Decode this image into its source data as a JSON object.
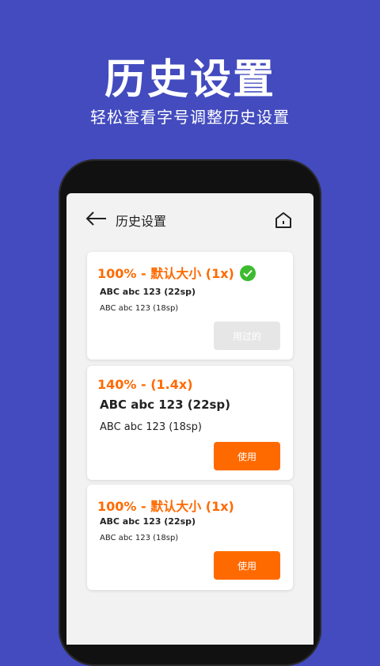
{
  "hero": {
    "title": "历史设置",
    "subtitle": "轻松查看字号调整历史设置"
  },
  "app": {
    "title": "历史设置",
    "back_icon": "arrow-left-icon",
    "home_icon": "home-icon"
  },
  "colors": {
    "background": "#434bbf",
    "accent": "#ff6a00",
    "check": "#3dbb2f",
    "used_button": "#e6e6e6"
  },
  "cards": [
    {
      "heading": "100% - 默认大小 (1x)",
      "sample_large": "ABC abc 123 (22sp)",
      "sample_small": "ABC abc 123 (18sp)",
      "button": "用过的",
      "current": true
    },
    {
      "heading": "140% - (1.4x)",
      "sample_large": "ABC abc 123 (22sp)",
      "sample_small": "ABC abc 123 (18sp)",
      "button": "使用",
      "current": false
    },
    {
      "heading": "100% - 默认大小 (1x)",
      "sample_large": "ABC abc 123 (22sp)",
      "sample_small": "ABC abc 123 (18sp)",
      "button": "使用",
      "current": false
    }
  ]
}
